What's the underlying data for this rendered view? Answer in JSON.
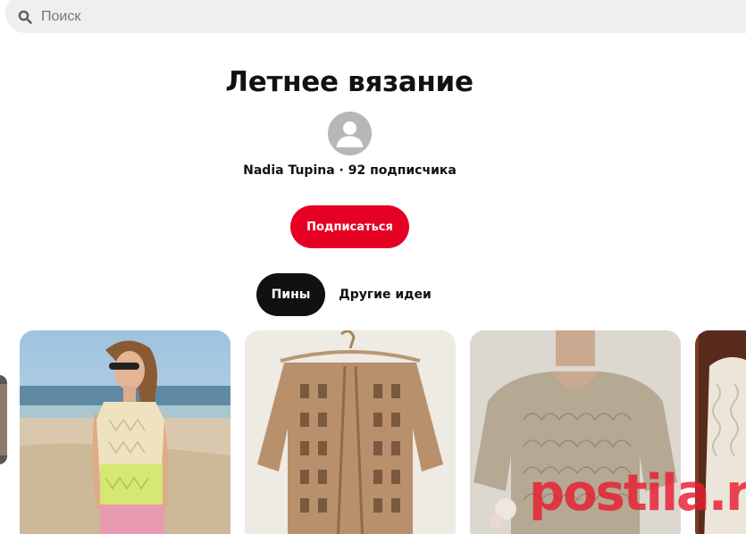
{
  "search": {
    "placeholder": "Поиск",
    "value": ""
  },
  "board": {
    "title": "Летнее вязание",
    "owner_name": "Nadia Tupina",
    "separator": " · ",
    "followers": "92 подписчика",
    "follow_label": "Подписаться"
  },
  "tabs": [
    {
      "label": "Пины",
      "active": true
    },
    {
      "label": "Другие идеи",
      "active": false
    }
  ],
  "pins": [
    {
      "icon": "photo-woman-beach-knit-top"
    },
    {
      "icon": "photo-knit-cardigan-hanger"
    },
    {
      "icon": "photo-knit-sweater-mannequin"
    },
    {
      "icon": "photo-white-knit-sweater"
    }
  ],
  "watermark": "postila.ru",
  "colors": {
    "accent": "#e60023",
    "search_bg": "#efefef",
    "tab_active_bg": "#111111"
  }
}
